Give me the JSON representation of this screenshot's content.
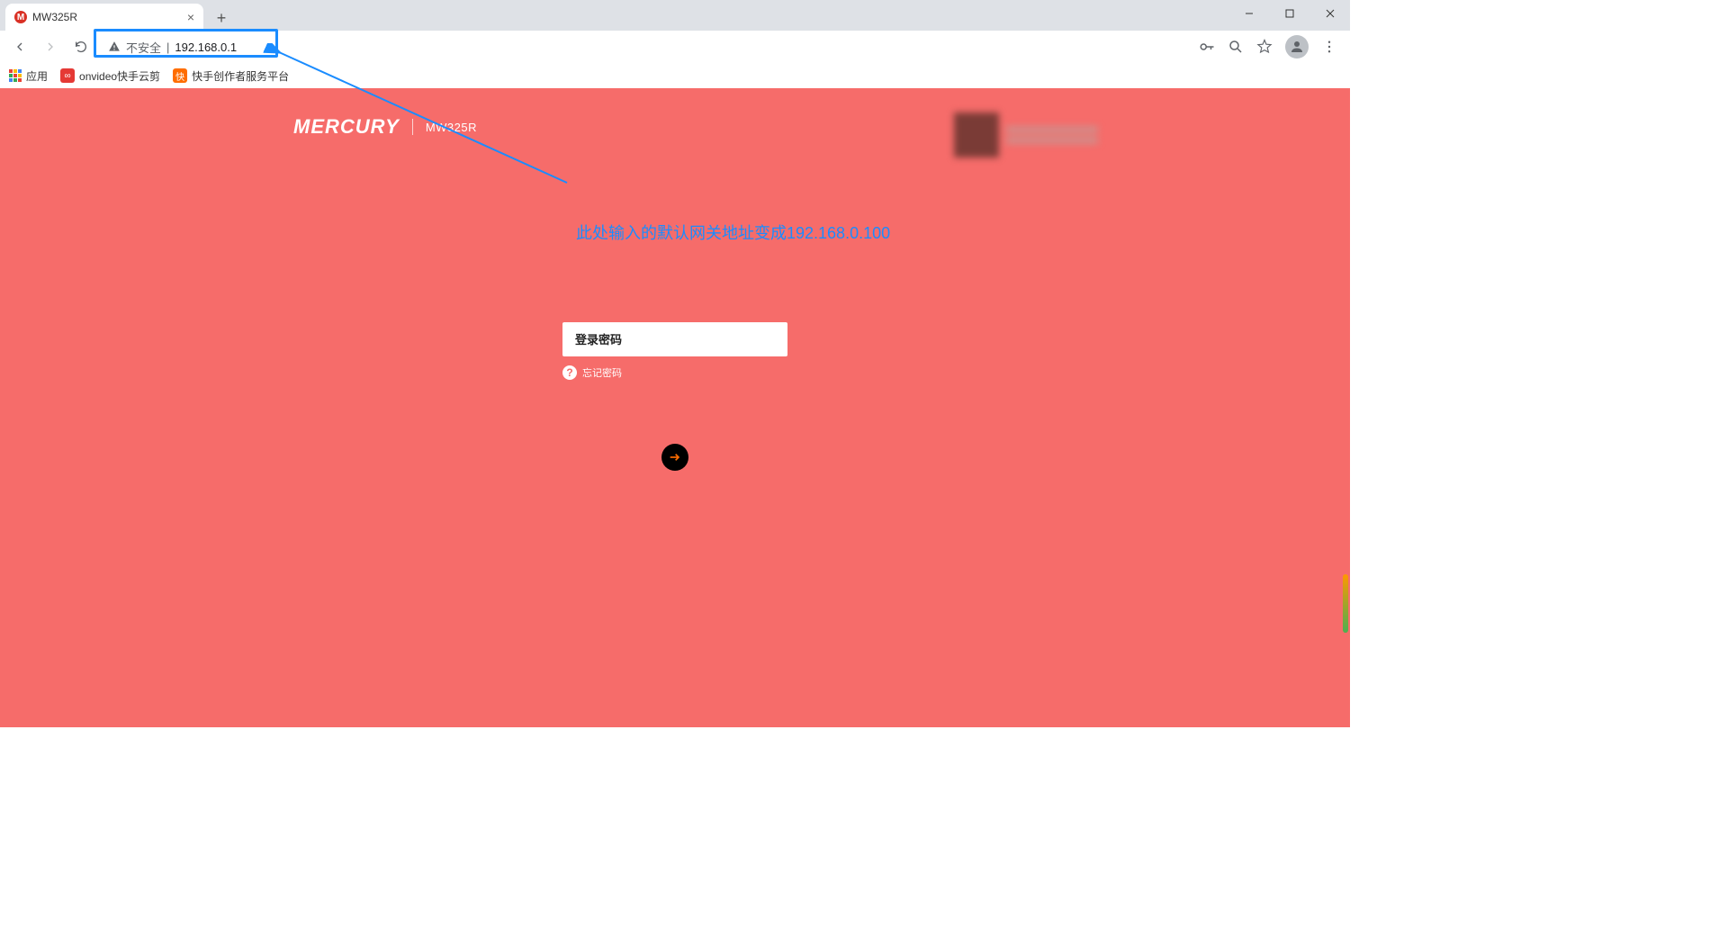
{
  "browser": {
    "tab_title": "MW325R",
    "security_label": "不安全",
    "url": "192.168.0.1",
    "bookmarks": {
      "apps": "应用",
      "item1": "onvideo快手云剪",
      "item2": "快手创作者服务平台"
    }
  },
  "annotation": {
    "text": "此处输入的默认网关地址变成192.168.0.100"
  },
  "brand": {
    "logo": "MERCURY",
    "model": "MW325R"
  },
  "login": {
    "placeholder": "登录密码",
    "forgot": "忘记密码"
  },
  "colors": {
    "accent": "#f66c6a",
    "annotation": "#1a8cff"
  }
}
